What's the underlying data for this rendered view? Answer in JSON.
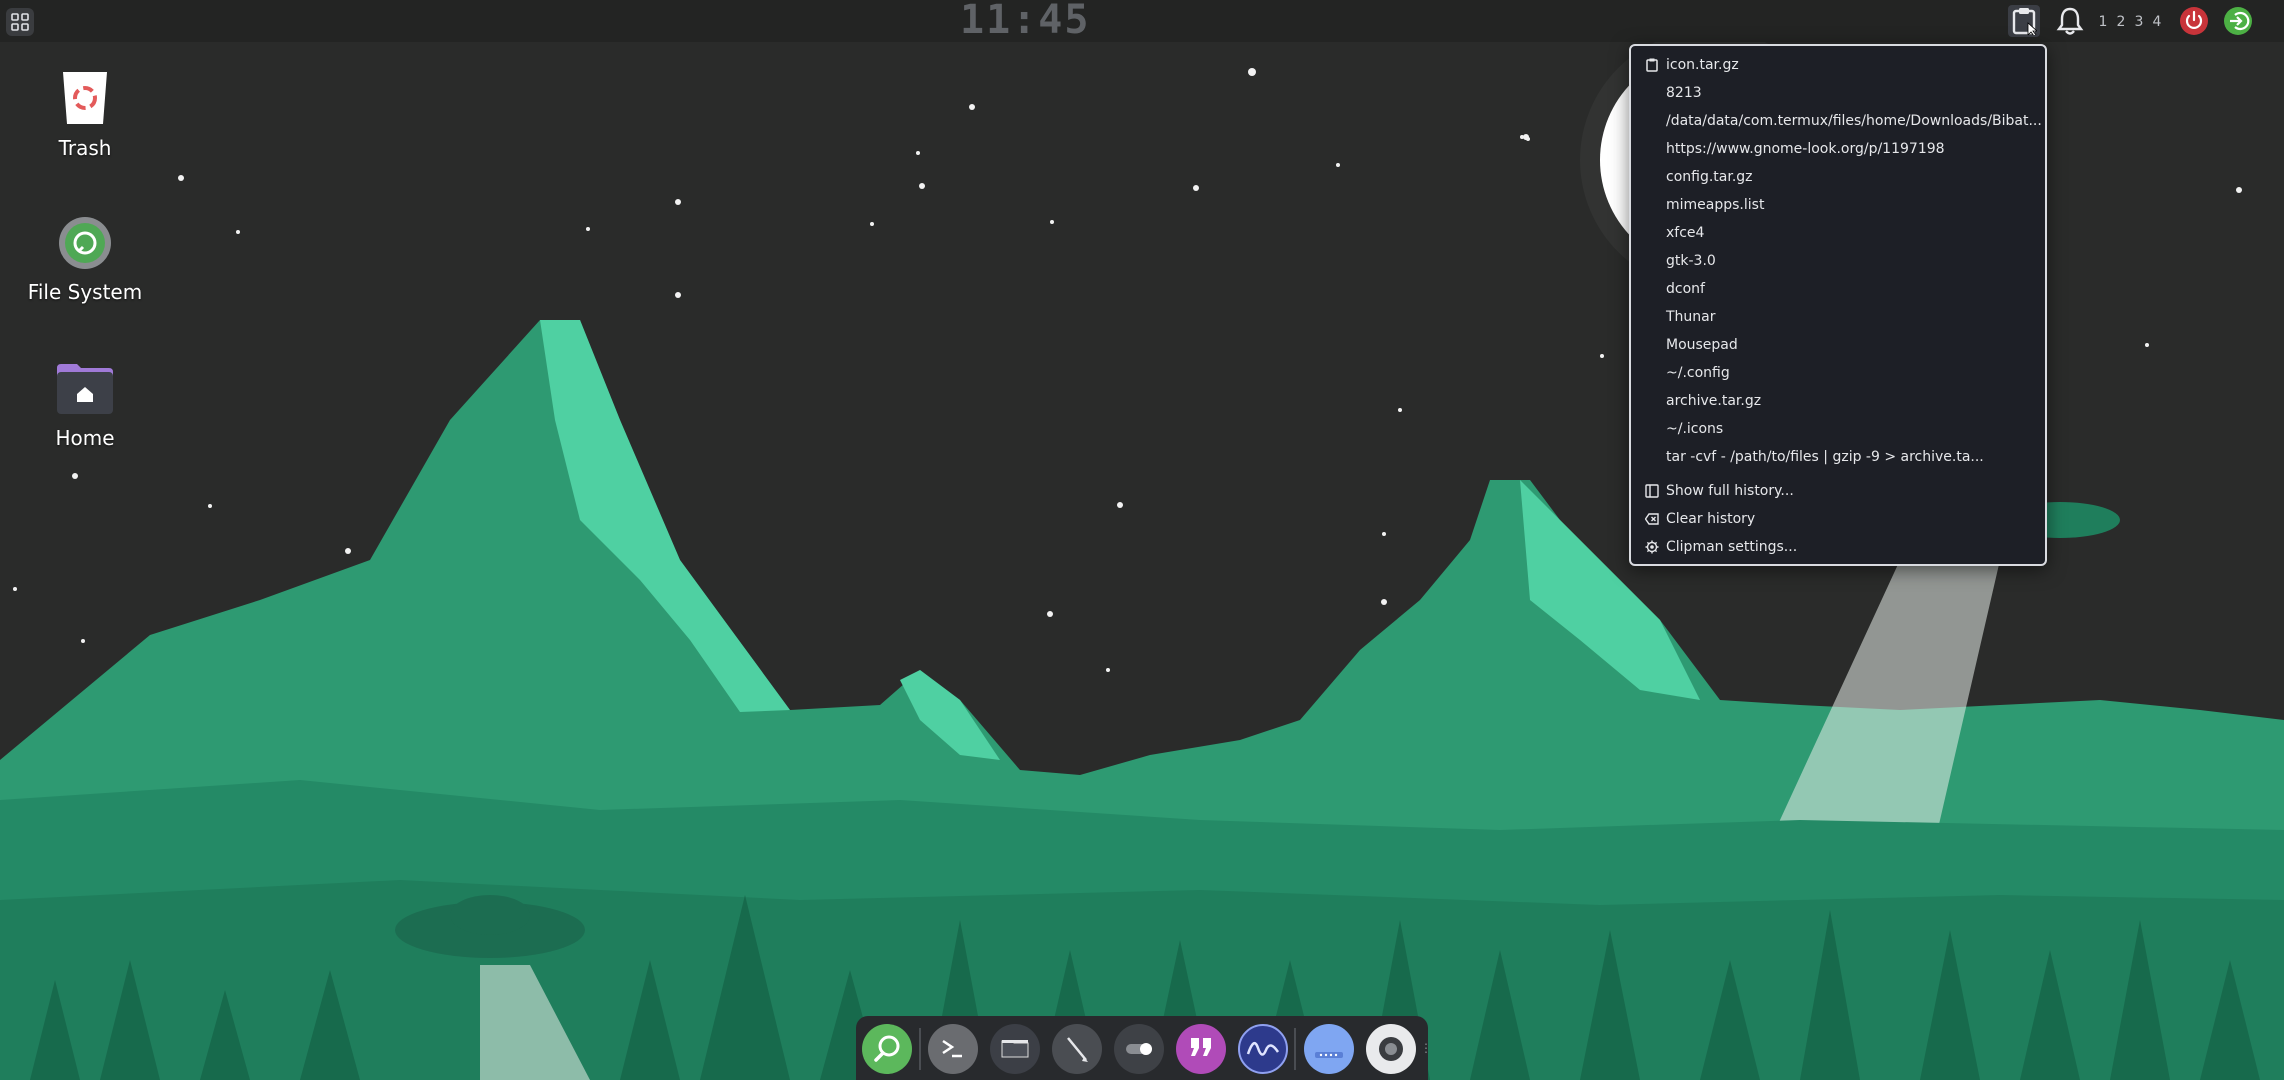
{
  "top_panel": {
    "clock": "11:45",
    "workspaces": [
      "1",
      "2",
      "3",
      "4"
    ]
  },
  "desktop": {
    "icons": [
      {
        "label": "Trash",
        "icon": "trash-icon"
      },
      {
        "label": "File System",
        "icon": "drive-icon"
      },
      {
        "label": "Home",
        "icon": "home-folder-icon"
      }
    ]
  },
  "clipman_menu": {
    "history": [
      "icon.tar.gz",
      "8213",
      "/data/data/com.termux/files/home/Downloads/Bibat...",
      "https://www.gnome-look.org/p/1197198",
      "config.tar.gz",
      "mimeapps.list",
      "xfce4",
      "gtk-3.0",
      "dconf",
      "Thunar",
      "Mousepad",
      "~/.config",
      "archive.tar.gz",
      "~/.icons",
      "tar -cvf - /path/to/files | gzip -9 > archive.ta..."
    ],
    "actions": {
      "show_history": "Show full history...",
      "clear_history": "Clear history",
      "settings": "Clipman settings..."
    }
  },
  "dock": {
    "items": [
      "search-icon",
      "terminal-icon",
      "files-icon",
      "editor-icon",
      "settings-toggle-icon",
      "quote-app-icon",
      "system-monitor-icon",
      "drive-app-icon",
      "screenshot-icon"
    ]
  },
  "colors": {
    "sky": "#2a2b2a",
    "mountain_dark": "#2e9a72",
    "mountain_light": "#4fd0a2",
    "forest": "#1f7e5c",
    "panel": "#232423",
    "menu_bg": "#1d1f26"
  }
}
